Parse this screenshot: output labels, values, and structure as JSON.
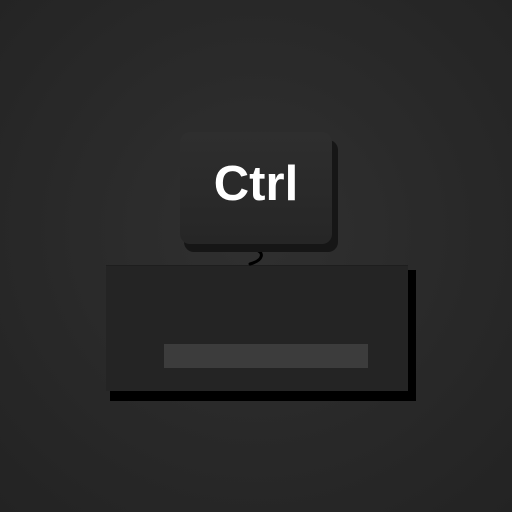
{
  "key": {
    "label": "Ctrl"
  },
  "keyboard": {
    "spacebar_icon": "spacebar-icon"
  },
  "colors": {
    "background": "#2a2a2a",
    "keycap": "#2b2b2b",
    "keyboard_body": "#242424",
    "spacebar": "#3c3c3c",
    "label": "#ffffff"
  }
}
